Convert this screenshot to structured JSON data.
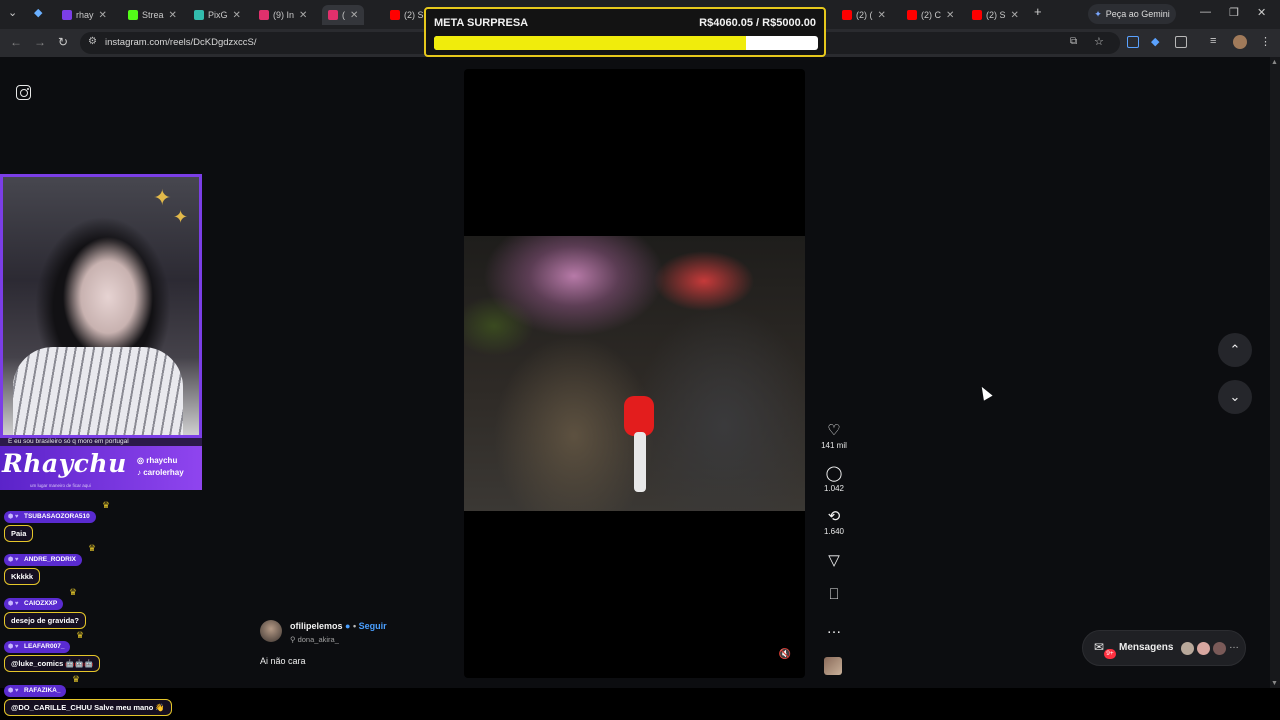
{
  "browser": {
    "tabs": [
      {
        "label": "rhay",
        "color": "#7b3ee6"
      },
      {
        "label": "Strea",
        "color": "#53fc18"
      },
      {
        "label": "PixG",
        "color": "#32bcad"
      },
      {
        "label": "(9) In",
        "color": "#e1306c"
      },
      {
        "label": "(",
        "color": "#e1306c"
      },
      {
        "label": "(2) S",
        "color": "#ff0000"
      },
      {
        "label": "(2) (",
        "color": "#ff0000"
      },
      {
        "label": "(2) C",
        "color": "#ff0000"
      },
      {
        "label": "(2) S",
        "color": "#ff0000"
      }
    ],
    "gemini_label": "Peça ao Gemini",
    "url": "instagram.com/reels/DcKDgdzxccS/"
  },
  "goal": {
    "title": "META SURPRESA",
    "amount": "R$4060.05 / R$5000.00",
    "progress": 0.812
  },
  "reel": {
    "likes": "141 mil",
    "comments": "1.042",
    "reposts": "1.640",
    "username": "ofilipelemos",
    "follow": "Seguir",
    "audio": "dona_akira_",
    "caption": "Ai não cara"
  },
  "messages": {
    "label": "Mensagens",
    "badge": "9+"
  },
  "stream": {
    "lower_text": "E eu sou brasileiro só q moro em portugal",
    "name": "Rhaychu",
    "handles": [
      "rhaychu",
      "carolerhay"
    ],
    "small_text": "um lugar maneiro de ficar aqui"
  },
  "chat": [
    {
      "user": "TSUBASAOZORA510",
      "text": "Paia"
    },
    {
      "user": "ANDRE_RODRIX",
      "text": "Kkkkk"
    },
    {
      "user": "CAIOZXXP",
      "text": "desejo de gravida?"
    },
    {
      "user": "LEAFAR007_",
      "text": "@luke_comics 🤖🤖🤖"
    },
    {
      "user": "RAFAZIKA_",
      "text": "@DO_CARILLE_CHUU Salve meu mano 👋"
    }
  ],
  "colors": {
    "accent_purple": "#7b3ee6",
    "goal_yellow": "#f0ec0c",
    "instagram_blue": "#4a9fff"
  }
}
